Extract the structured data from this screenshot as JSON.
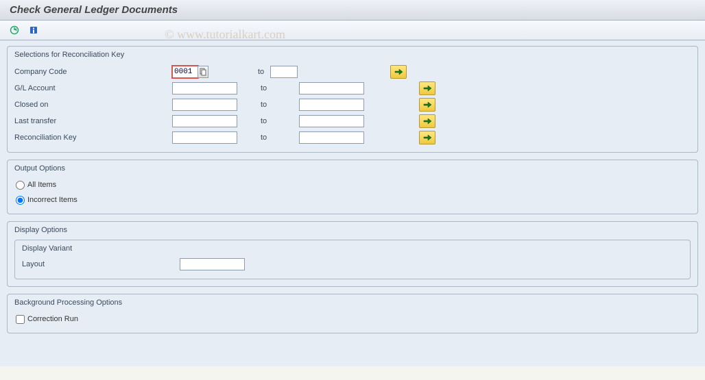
{
  "header": {
    "title": "Check General Ledger Documents"
  },
  "watermark": "© www.tutorialkart.com",
  "toolbar": {
    "execute_tooltip": "Execute",
    "info_tooltip": "Information"
  },
  "selections": {
    "title": "Selections for Reconciliation Key",
    "rows": [
      {
        "label": "Company Code",
        "from": "0001",
        "to": "",
        "to_label": "to",
        "hasF4": true,
        "wide": false
      },
      {
        "label": "G/L Account",
        "from": "",
        "to": "",
        "to_label": "to",
        "hasF4": false,
        "wide": true
      },
      {
        "label": "Closed on",
        "from": "",
        "to": "",
        "to_label": "to",
        "hasF4": false,
        "wide": true
      },
      {
        "label": "Last transfer",
        "from": "",
        "to": "",
        "to_label": "to",
        "hasF4": false,
        "wide": true
      },
      {
        "label": "Reconciliation Key",
        "from": "",
        "to": "",
        "to_label": "to",
        "hasF4": false,
        "wide": true
      }
    ]
  },
  "output": {
    "title": "Output Options",
    "options": [
      {
        "label": "All Items",
        "checked": false
      },
      {
        "label": "Incorrect Items",
        "checked": true
      }
    ]
  },
  "display": {
    "title": "Display Options",
    "subgroup_title": "Display Variant",
    "layout_label": "Layout",
    "layout_value": ""
  },
  "background": {
    "title": "Background Processing Options",
    "correction_label": "Correction Run",
    "correction_checked": false
  }
}
